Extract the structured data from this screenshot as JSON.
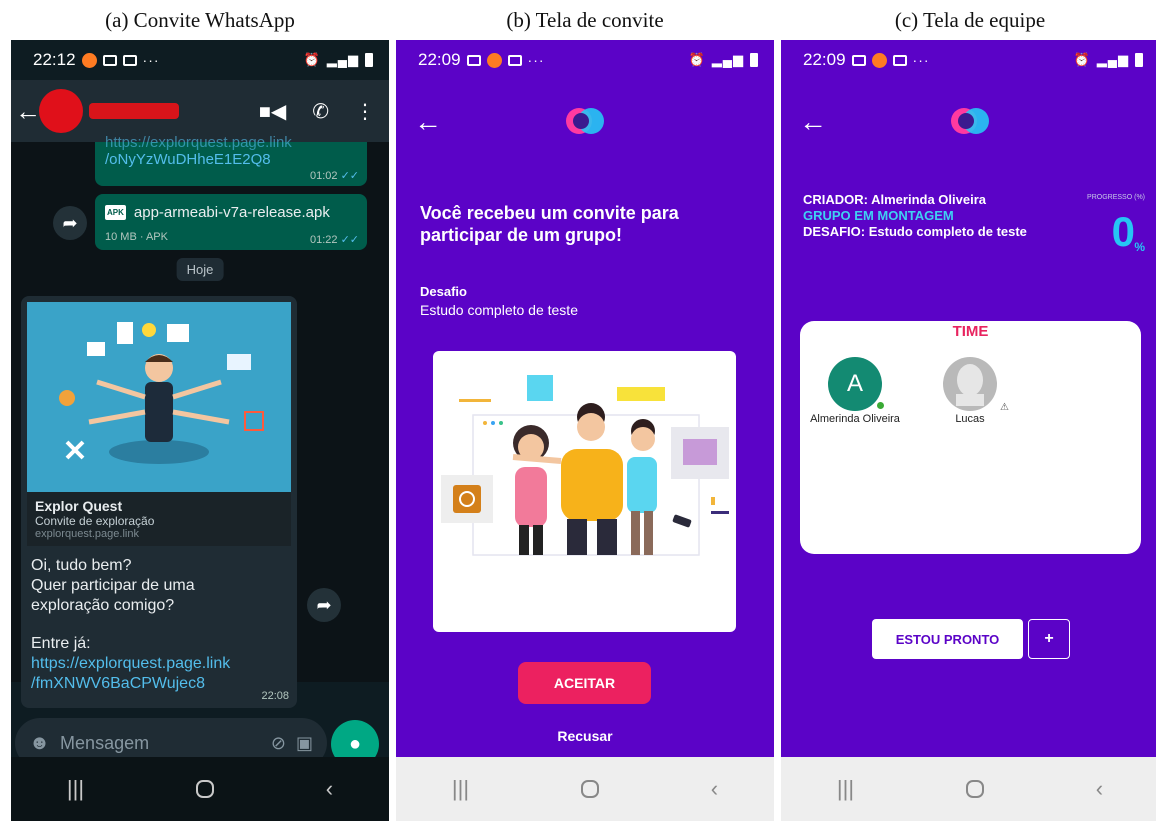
{
  "captions": [
    "(a) Convite WhatsApp",
    "(b) Tela de convite",
    "(c) Tela de equipe"
  ],
  "whatsapp": {
    "status_time": "22:12",
    "link_partial": "https://explorquest.page.link",
    "link_tail": "/oNyYzWuDHheE1E2Q8",
    "link_time": "01:02",
    "file_name": "app-armeabi-v7a-release.apk",
    "file_badge": "APK",
    "file_meta": "10 MB · APK",
    "file_time": "01:22",
    "day_label": "Hoje",
    "preview": {
      "title": "Explor Quest",
      "subtitle": "Convite de exploração",
      "domain": "explorquest.page.link"
    },
    "message_lines": [
      "Oi, tudo bem?",
      "Quer participar de uma",
      "exploração comigo?"
    ],
    "enter_label": "Entre já:",
    "invite_link_1": "https://explorquest.page.link",
    "invite_link_2": "/fmXNWV6BaCPWujec8",
    "message_time": "22:08",
    "input_placeholder": "Mensagem"
  },
  "invite_screen": {
    "status_time": "22:09",
    "title": "Você recebeu um convite para participar de um grupo!",
    "challenge_label": "Desafio",
    "challenge_value": "Estudo completo de teste",
    "accept_label": "ACEITAR",
    "decline_label": "Recusar"
  },
  "team_screen": {
    "status_time": "22:09",
    "creator": "CRIADOR: Almerinda Oliveira",
    "group_status": "GRUPO EM MONTAGEM",
    "challenge": "DESAFIO: Estudo completo de teste",
    "progress_label": "PROGRESSO (%)",
    "progress_value": "0",
    "progress_unit": "%",
    "team_title": "TIME",
    "members": [
      {
        "initial": "A",
        "name": "Almerinda Oliveira"
      },
      {
        "initial": "",
        "name": "Lucas"
      }
    ],
    "ready_label": "ESTOU PRONTO",
    "add_label": "+"
  },
  "colors": {
    "purple": "#5b03c7",
    "accent_pink": "#ec2160",
    "accent_cyan": "#26c6f4",
    "whatsapp_green": "#00a884"
  }
}
